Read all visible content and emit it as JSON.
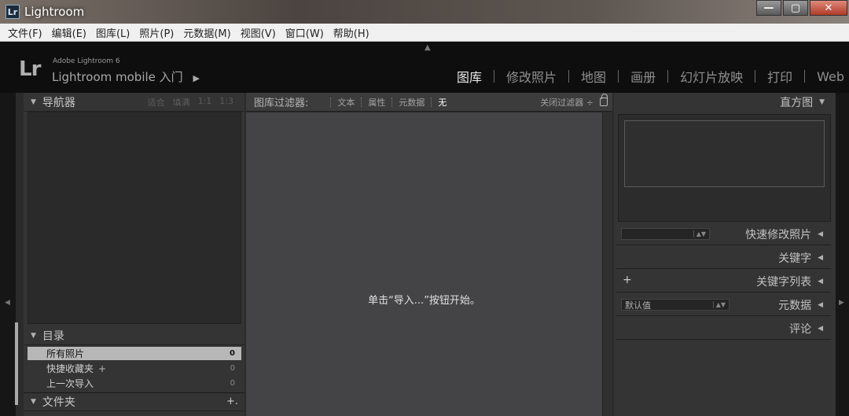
{
  "window": {
    "title": "Lightroom",
    "icon_text": "Lr",
    "buttons": {
      "minimize": "—",
      "maximize": "▢",
      "close": "✕"
    }
  },
  "menu": [
    "文件(F)",
    "编辑(E)",
    "图库(L)",
    "照片(P)",
    "元数据(M)",
    "视图(V)",
    "窗口(W)",
    "帮助(H)"
  ],
  "identity": {
    "logo": "Lr",
    "product": "Adobe Lightroom 6",
    "mobile": "Lightroom mobile 入门",
    "mobile_arrow": "▶"
  },
  "modules": [
    {
      "label": "图库",
      "active": true
    },
    {
      "label": "修改照片",
      "active": false
    },
    {
      "label": "地图",
      "active": false
    },
    {
      "label": "画册",
      "active": false
    },
    {
      "label": "幻灯片放映",
      "active": false
    },
    {
      "label": "打印",
      "active": false
    },
    {
      "label": "Web",
      "active": false
    }
  ],
  "left_panel": {
    "navigator": {
      "title": "导航器",
      "options": [
        "适合",
        "填满",
        "1:1",
        "1:3"
      ]
    },
    "catalog": {
      "title": "目录",
      "items": [
        {
          "label": "所有照片",
          "count": "0",
          "selected": true
        },
        {
          "label": "快捷收藏夹",
          "count": "0",
          "plus": "+"
        },
        {
          "label": "上一次导入",
          "count": "0"
        }
      ]
    },
    "folders": {
      "title": "文件夹",
      "plus": "+."
    }
  },
  "filter_bar": {
    "title": "图库过滤器:",
    "options": [
      "文本",
      "属性",
      "元数据",
      "无"
    ],
    "active": "无",
    "close": "关闭过滤器 ÷"
  },
  "center": {
    "empty_message": "单击“导入...”按钮开始。"
  },
  "right_panel": {
    "histogram": {
      "title": "直方图"
    },
    "quick_develop": {
      "title": "快速修改照片",
      "preset": ""
    },
    "keywording": {
      "title": "关键字"
    },
    "keyword_list": {
      "title": "关键字列表",
      "plus": "+"
    },
    "metadata": {
      "title": "元数据",
      "preset": "默认值"
    },
    "comments": {
      "title": "评论"
    }
  },
  "colors": {
    "background": "#2b2b2b",
    "panel": "#343434",
    "grid": "#444346",
    "header": "#0e0e0e"
  }
}
